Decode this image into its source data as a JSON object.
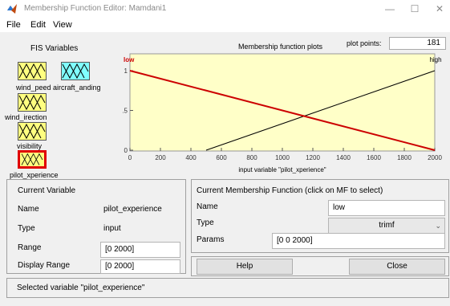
{
  "window": {
    "title": "Membership Function Editor: Mamdani1",
    "minimize": "—",
    "maximize": "☐",
    "close": "✕"
  },
  "menu": [
    "File",
    "Edit",
    "View"
  ],
  "fis_variables": {
    "heading": "FIS Variables",
    "inputs": [
      "wind_peed",
      "wind_irection",
      "visibility",
      "pilot_xperience"
    ],
    "outputs": [
      "aircraft_anding"
    ]
  },
  "plot": {
    "title": "Membership function plots",
    "plot_points_label": "plot points:",
    "plot_points_value": "181",
    "xlabel": "input variable \"pilot_xperience\"",
    "mf_labels": [
      "low",
      "high"
    ],
    "x_ticks": [
      "0",
      "200",
      "400",
      "600",
      "800",
      "1000",
      "1200",
      "1400",
      "1600",
      "1800",
      "2000"
    ],
    "y_ticks": [
      "0",
      "0.5",
      "1"
    ],
    "colors": {
      "background": "#ffffc8",
      "selected_mf": "#cc0000",
      "other_mf": "#000000"
    }
  },
  "chart_data": {
    "type": "line",
    "xlim": [
      0,
      2000
    ],
    "ylim": [
      0,
      1
    ],
    "series": [
      {
        "name": "low",
        "x": [
          0,
          0,
          2000
        ],
        "y": [
          1,
          1,
          0
        ]
      },
      {
        "name": "high",
        "x": [
          500,
          2000,
          2000
        ],
        "y": [
          0,
          1,
          1
        ]
      }
    ]
  },
  "current_variable": {
    "heading": "Current Variable",
    "name_label": "Name",
    "name_value": "pilot_experience",
    "type_label": "Type",
    "type_value": "input",
    "range_label": "Range",
    "range_value": "[0 2000]",
    "display_range_label": "Display Range",
    "display_range_value": "[0 2000]"
  },
  "current_mf": {
    "heading": "Current Membership Function (click on MF to select)",
    "name_label": "Name",
    "name_value": "low",
    "type_label": "Type",
    "type_value": "trimf",
    "params_label": "Params",
    "params_value": "[0 0 2000]",
    "help_label": "Help",
    "close_label": "Close"
  },
  "status": {
    "text": "Selected variable \"pilot_experience\""
  }
}
